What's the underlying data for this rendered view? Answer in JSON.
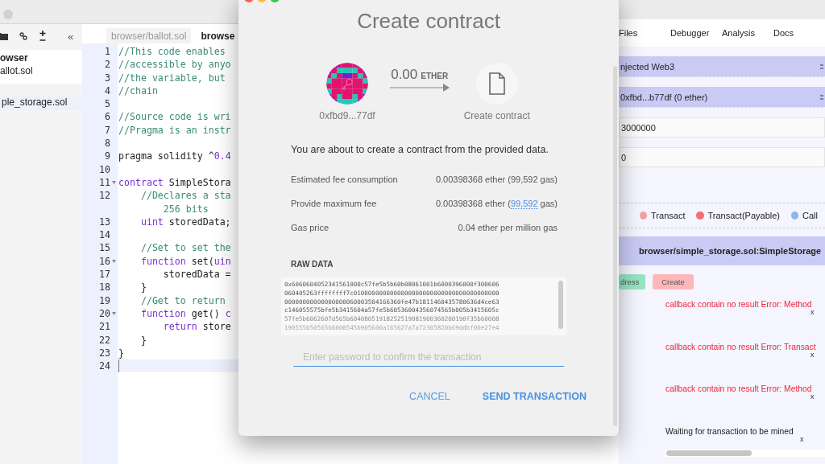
{
  "left_panel": {
    "toolbar": [
      {
        "kind": "folder"
      },
      {
        "kind": "link"
      },
      {
        "kind": "plus-minus"
      },
      {
        "kind": "collapse",
        "glyph": "«"
      }
    ],
    "files": [
      {
        "name": "owser",
        "kind": "folder",
        "selected": false
      },
      {
        "name": "allot.sol",
        "kind": "file",
        "selected": false
      },
      {
        "name": "ple_storage.sol",
        "kind": "file",
        "selected": true
      }
    ]
  },
  "editor": {
    "tabs": [
      {
        "label": "browser/ballot.sol",
        "selected": false
      },
      {
        "label": "browse",
        "selected": true
      }
    ],
    "lines": [
      {
        "number": "1",
        "fold": false,
        "current": false,
        "segments": [
          {
            "kind": "comment",
            "text": "//This code enables"
          }
        ]
      },
      {
        "number": "2",
        "fold": false,
        "current": false,
        "segments": [
          {
            "kind": "comment",
            "text": "//accessible by anyo"
          }
        ]
      },
      {
        "number": "3",
        "fold": false,
        "current": false,
        "segments": [
          {
            "kind": "comment",
            "text": "//the variable, but"
          }
        ]
      },
      {
        "number": "4",
        "fold": false,
        "current": false,
        "segments": [
          {
            "kind": "comment",
            "text": "//chain"
          }
        ]
      },
      {
        "number": "5",
        "fold": false,
        "current": false
      },
      {
        "number": "6",
        "fold": false,
        "current": false,
        "segments": [
          {
            "kind": "comment",
            "text": "//Source code is wri"
          }
        ]
      },
      {
        "number": "7",
        "fold": false,
        "current": false,
        "segments": [
          {
            "kind": "comment",
            "text": "//Pragma is an instr"
          }
        ]
      },
      {
        "number": "8",
        "fold": false,
        "current": false
      },
      {
        "number": "9",
        "fold": false,
        "current": false,
        "segments": [
          {
            "kind": "plain",
            "text": "pragma solidity ^"
          },
          {
            "kind": "number",
            "text": "0.4"
          }
        ]
      },
      {
        "number": "10",
        "fold": false,
        "current": false
      },
      {
        "number": "11",
        "fold": true,
        "current": false,
        "segments": [
          {
            "kind": "keyword",
            "text": "contract"
          },
          {
            "kind": "plain",
            "text": " SimpleStora"
          }
        ]
      },
      {
        "number": "12",
        "fold": false,
        "current": false,
        "segments": [
          {
            "kind": "comment",
            "text": "    //Declares a sta"
          }
        ],
        "wrap": "        256 bits"
      },
      {
        "number": "13",
        "fold": false,
        "current": false,
        "segments": [
          {
            "kind": "keyword",
            "text": "    uint"
          },
          {
            "kind": "plain",
            "text": " storedData;"
          }
        ]
      },
      {
        "number": "14",
        "fold": false,
        "current": false
      },
      {
        "number": "15",
        "fold": false,
        "current": false,
        "segments": [
          {
            "kind": "comment",
            "text": "    //Set to set the"
          }
        ]
      },
      {
        "number": "16",
        "fold": true,
        "current": false,
        "segments": [
          {
            "kind": "keyword",
            "text": "    function"
          },
          {
            "kind": "plain",
            "text": " set("
          },
          {
            "kind": "keyword",
            "text": "uin"
          }
        ]
      },
      {
        "number": "17",
        "fold": false,
        "current": false,
        "segments": [
          {
            "kind": "plain",
            "text": "        storedData ="
          }
        ]
      },
      {
        "number": "18",
        "fold": false,
        "current": false,
        "segments": [
          {
            "kind": "plain",
            "text": "    }"
          }
        ]
      },
      {
        "number": "19",
        "fold": false,
        "current": false,
        "segments": [
          {
            "kind": "comment",
            "text": "    //Get to return"
          }
        ]
      },
      {
        "number": "20",
        "fold": true,
        "current": false,
        "segments": [
          {
            "kind": "keyword",
            "text": "    function"
          },
          {
            "kind": "plain",
            "text": " get() "
          },
          {
            "kind": "keyword",
            "text": "c"
          }
        ]
      },
      {
        "number": "21",
        "fold": false,
        "current": false,
        "segments": [
          {
            "kind": "keyword",
            "text": "        return"
          },
          {
            "kind": "plain",
            "text": " store"
          }
        ]
      },
      {
        "number": "22",
        "fold": false,
        "current": false,
        "segments": [
          {
            "kind": "plain",
            "text": "    }"
          }
        ]
      },
      {
        "number": "23",
        "fold": false,
        "current": false,
        "segments": [
          {
            "kind": "plain",
            "text": "}"
          }
        ]
      },
      {
        "number": "24",
        "fold": false,
        "current": true
      }
    ]
  },
  "dialog": {
    "title": "Create contract",
    "from": {
      "address": "0xfbd9...77df"
    },
    "amount": "0.00",
    "unit": "ETHER",
    "to": {
      "label": "Create contract"
    },
    "message": "You are about to create a contract from the provided data.",
    "details": [
      {
        "label": "Estimated fee consumption",
        "value": "0.00398368 ether (99,592 gas)"
      },
      {
        "label": "Provide maximum fee",
        "value": "0.00398368 ether (",
        "link": "99,592",
        "value_end": " gas)"
      },
      {
        "label": "Gas price",
        "value": "0.04 ether per million gas"
      }
    ],
    "raw_data_heading": "RAW DATA",
    "raw_data": [
      "0x6060604052341561000c57fe5b5b60b08061001b6000396000f300606",
      "060405263ffffffff7c0100000000000000000000000000000000000000",
      "00000000000000000060003504166360fe47b1811460435780636d4ce63",
      "c146055575bfe5b3415604a57fe5b60536004356074565b005b3415605c",
      "57fe5b6062607d565b60408051918252519081900360200190f35b60008",
      "190555b50565b6000545b905600a165627a7a72305820b69ddbf00e27e4"
    ],
    "password": {
      "placeholder": "Enter password to confirm the transaction"
    },
    "buttons": [
      {
        "label": "CANCEL",
        "kind": "secondary"
      },
      {
        "label": "SEND TRANSACTION",
        "kind": "primary"
      }
    ]
  },
  "right_panel": {
    "tabs": [
      {
        "label": "Files",
        "selected": false
      },
      {
        "label": "Debugger",
        "selected": false
      },
      {
        "label": "Analysis",
        "selected": false
      },
      {
        "label": "Docs",
        "selected": false
      }
    ],
    "environment": "njected Web3",
    "account": "0xfbd...b77df (0 ether)",
    "gas_limit": "3000000",
    "value": "0",
    "legend": [
      {
        "label": "Transact",
        "color": "#f4a0a3"
      },
      {
        "label": "Transact(Payable)",
        "color": "#f36f78"
      },
      {
        "label": "Call",
        "color": "#8fb4ee"
      }
    ],
    "contract": "browser/simple_storage.sol:SimpleStorage",
    "actions": [
      {
        "label": "dress",
        "kind": "at-address"
      },
      {
        "label": "Create",
        "kind": "create"
      }
    ],
    "messages": [
      {
        "kind": "error",
        "text": "callback contain no result Error: Method",
        "close": "x"
      },
      {
        "kind": "error",
        "text": "callback contain no result Error: Transact",
        "close": "x"
      },
      {
        "kind": "error",
        "text": "callback contain no result Error: Method",
        "close": "x"
      },
      {
        "kind": "info",
        "text": "Waiting for transaction to be mined",
        "close": "x"
      }
    ]
  }
}
